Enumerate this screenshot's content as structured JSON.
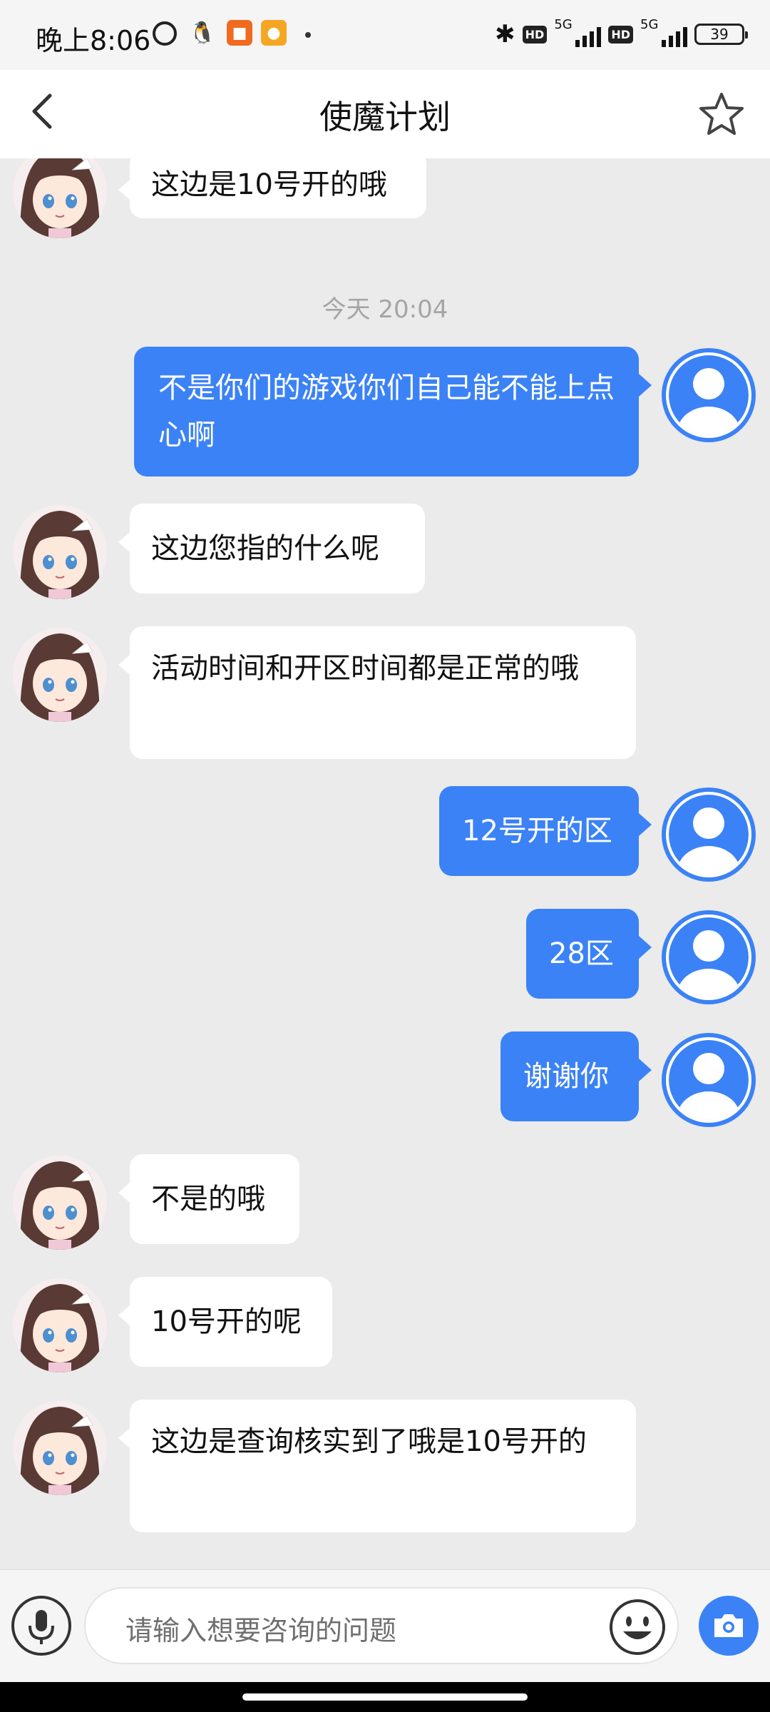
{
  "status_bar": {
    "time": "晚上8:06",
    "network_1": "5G",
    "network_2": "5G",
    "hd_label": "HD",
    "battery": "39",
    "icons": [
      "alarm-icon",
      "qq-icon",
      "video-app-icon",
      "app-icon",
      "dot-icon",
      "bluetooth-icon",
      "hd-icon",
      "signal-icon",
      "battery-icon"
    ]
  },
  "header": {
    "title": "使魔计划",
    "back_icon": "chevron-left-icon",
    "star_icon": "star-icon"
  },
  "chat": {
    "timestamp": "今天 20:04",
    "messages": [
      {
        "side": "left",
        "text": "这边是10号开的哦"
      },
      {
        "side": "right",
        "text": "不是你们的游戏你们自己能不能上点心啊"
      },
      {
        "side": "left",
        "text": "这边您指的什么呢"
      },
      {
        "side": "left",
        "text": "活动时间和开区时间都是正常的哦"
      },
      {
        "side": "right",
        "text": "12号开的区"
      },
      {
        "side": "right",
        "text": "28区"
      },
      {
        "side": "right",
        "text": "谢谢你"
      },
      {
        "side": "left",
        "text": "不是的哦"
      },
      {
        "side": "left",
        "text": "10号开的呢"
      },
      {
        "side": "left",
        "text": "这边是查询核实到了哦是10号开的"
      }
    ]
  },
  "input_bar": {
    "placeholder": "请输入想要咨询的问题",
    "mic_icon": "microphone-icon",
    "emoji_icon": "emoji-icon",
    "camera_icon": "camera-icon"
  },
  "colors": {
    "accent": "#3b82f6",
    "chat_bg": "#ebebeb",
    "bubble_left": "#ffffff"
  }
}
